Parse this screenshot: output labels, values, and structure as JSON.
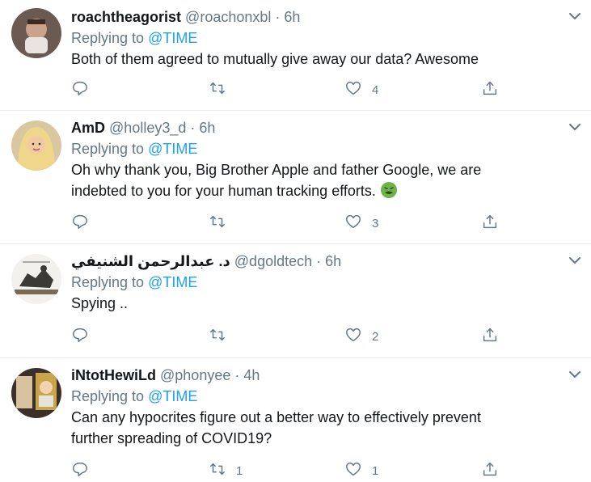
{
  "tweets": [
    {
      "display_name": "roachtheagorist",
      "handle": "@roachonxbl",
      "dot": "·",
      "time": "6h",
      "replying_label": "Replying to ",
      "replying_to": "@TIME",
      "text_lines": [
        "Both of them agreed to mutually give away our data? Awesome"
      ],
      "reply_count": "",
      "retweet_count": "",
      "like_count": "4"
    },
    {
      "display_name": "AmD",
      "handle": "@holley3_d",
      "dot": "·",
      "time": "6h",
      "replying_label": "Replying to ",
      "replying_to": "@TIME",
      "text_lines": [
        "Oh why thank you, Big Brother Apple and father Google, we are",
        "indebted to you for your human tracking efforts. "
      ],
      "emoji": "nauseated-face-emoji",
      "reply_count": "",
      "retweet_count": "",
      "like_count": "3"
    },
    {
      "display_name": "د. عبدالرحمن الشنيفي",
      "handle": "@dgoldtech",
      "dot": "·",
      "time": "6h",
      "replying_label": "Replying to ",
      "replying_to": "@TIME",
      "text_lines": [
        "Spying .."
      ],
      "reply_count": "",
      "retweet_count": "",
      "like_count": "2"
    },
    {
      "display_name": "iNtotHewiLd",
      "handle": "@phonyee",
      "dot": "·",
      "time": "4h",
      "replying_label": "Replying to ",
      "replying_to": "@TIME",
      "text_lines": [
        "Can any hypocrites figure out a better way to effectively prevent",
        "further spreading of COVID19?"
      ],
      "reply_count": "",
      "retweet_count": "1",
      "like_count": "1"
    }
  ],
  "colors": {
    "accent": "#1da1f2",
    "secondary_text": "#657786",
    "primary_text": "#14171a",
    "divider": "#e6ecf0"
  },
  "icons": [
    "reply-icon",
    "retweet-icon",
    "like-icon",
    "share-icon",
    "chevron-down-icon"
  ]
}
